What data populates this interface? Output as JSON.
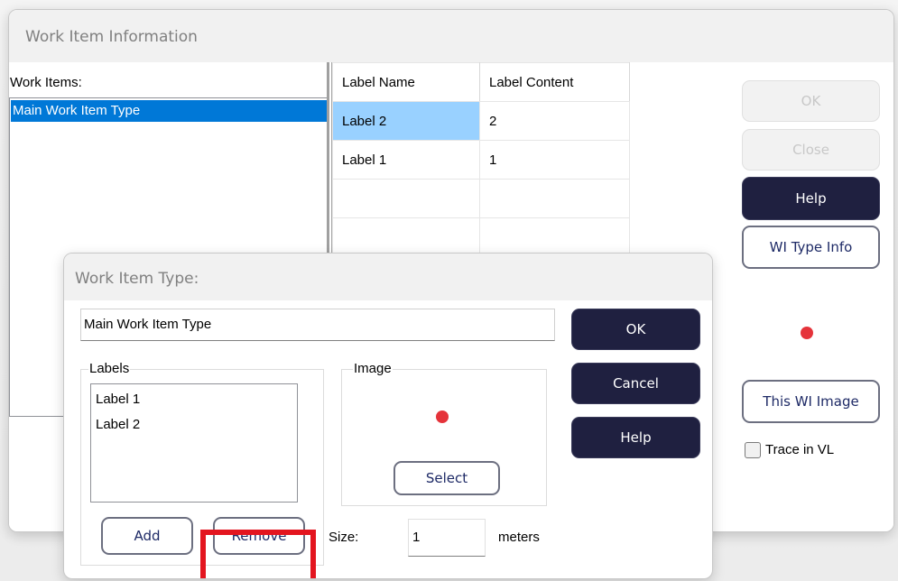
{
  "main_dialog": {
    "title": "Work Item Information",
    "work_items_label": "Work Items:",
    "work_items": [
      "Main Work Item Type"
    ],
    "selected_work_item": "Main Work Item Type",
    "table": {
      "columns": [
        "Label Name",
        "Label Content"
      ],
      "rows": [
        {
          "name": "Label 2",
          "content": "2",
          "selected": true
        },
        {
          "name": "Label 1",
          "content": "1",
          "selected": false
        }
      ]
    },
    "buttons": {
      "ok": "OK",
      "close": "Close",
      "help": "Help",
      "wi_type_info": "WI Type Info",
      "this_wi_image": "This WI Image"
    },
    "image_color": "#e5333a",
    "trace_checkbox": {
      "label": "Trace in VL",
      "checked": false
    }
  },
  "sub_dialog": {
    "title": "Work Item Type:",
    "name_value": "Main Work Item Type",
    "labels_group": {
      "title": "Labels",
      "items": [
        "Label 1",
        "Label 2"
      ],
      "add_label": "Add",
      "remove_label": "Remove"
    },
    "image_group": {
      "title": "Image",
      "select_label": "Select"
    },
    "size": {
      "label": "Size:",
      "value": "1",
      "unit": "meters"
    },
    "buttons": {
      "ok": "OK",
      "cancel": "Cancel",
      "help": "Help"
    },
    "highlight_color": "#e3151f"
  }
}
